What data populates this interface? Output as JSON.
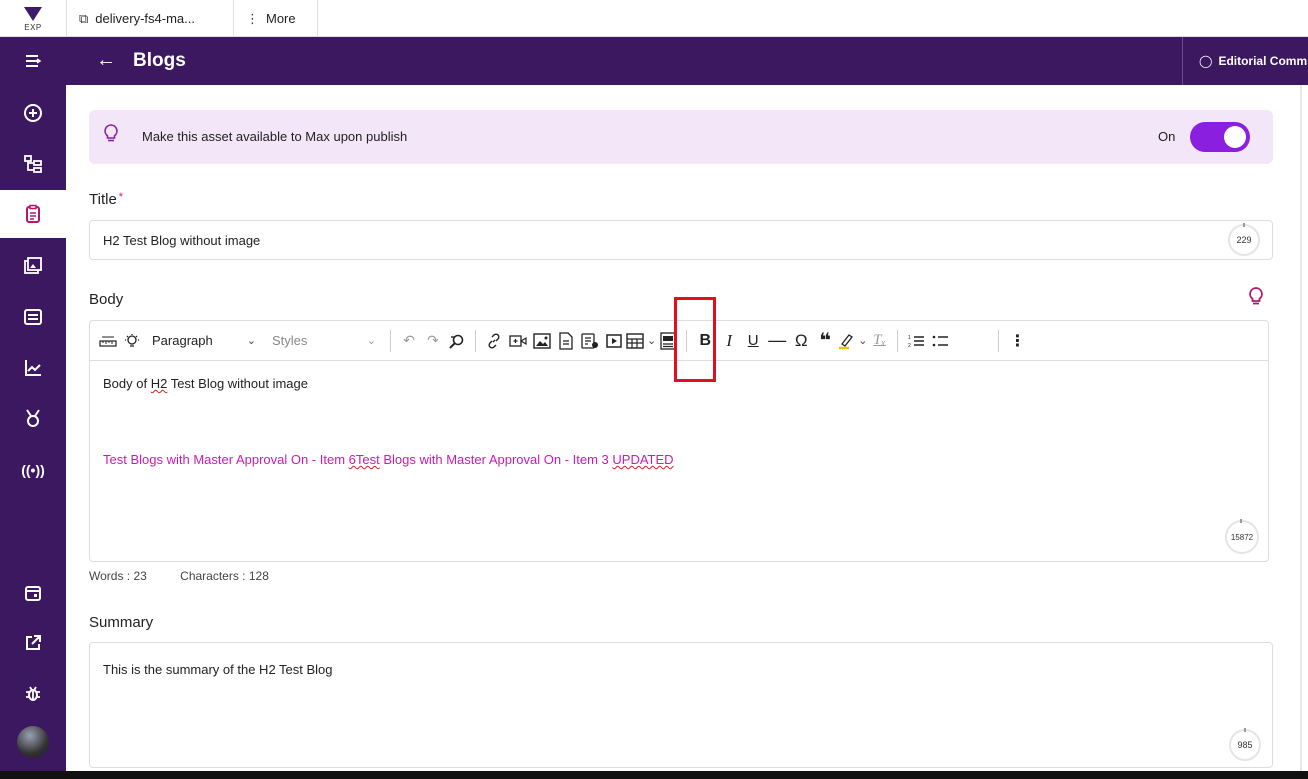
{
  "top_tabs": {
    "logo_text": "EXP",
    "tab1_label": "delivery-fs4-ma...",
    "tab2_label": "More"
  },
  "header": {
    "back_icon": "arrow-left-icon",
    "title": "Blogs",
    "editorial_label": "Editorial Comm"
  },
  "sidebar": {
    "items": [
      {
        "icon": "collapse-menu-icon"
      },
      {
        "icon": "plus-circle-icon"
      },
      {
        "icon": "hierarchy-icon"
      },
      {
        "icon": "clipboard-icon",
        "active": true
      },
      {
        "icon": "media-gallery-icon"
      },
      {
        "icon": "news-icon"
      },
      {
        "icon": "chart-line-icon"
      },
      {
        "icon": "award-icon"
      },
      {
        "icon": "broadcast-icon"
      },
      {
        "icon": "calendar-icon"
      },
      {
        "icon": "external-link-icon"
      },
      {
        "icon": "bug-icon"
      }
    ]
  },
  "banner": {
    "text": "Make this asset available to Max upon publish",
    "toggle_label": "On",
    "toggle_on": true
  },
  "title_field": {
    "label": "Title",
    "required_mark": "*",
    "value": "H2 Test Blog without image",
    "counter": "229"
  },
  "body_field": {
    "label": "Body",
    "paragraph_select": "Paragraph",
    "styles_select": "Styles",
    "line1_prefix": "Body of ",
    "line1_mark": "H2",
    "line1_suffix": " Test Blog without image",
    "line2_part1": "Test Blogs with Master Approval On - Item ",
    "line2_mark1": "6Test",
    "line2_part2": " Blogs with Master Approval On - Item 3 ",
    "line2_mark2": "UPDATED",
    "counter": "15872",
    "words": "Words : 23",
    "characters": "Characters : 128"
  },
  "summary_field": {
    "label": "Summary",
    "value": "This is the summary of the H2 Test Blog",
    "counter": "985"
  },
  "colors": {
    "brand_purple": "#3b1860",
    "toggle": "#8a1fe0",
    "link_pink": "#c81bb8",
    "highlight_box": "#e0101e"
  }
}
